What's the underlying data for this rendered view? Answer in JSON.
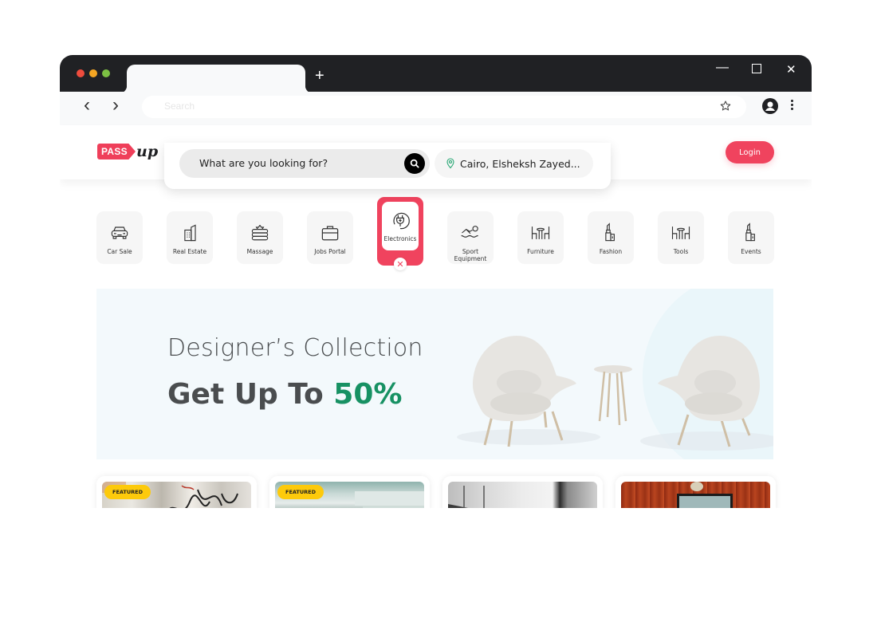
{
  "browser": {
    "new_tab_symbol": "+",
    "window_controls": {
      "minimize": "—",
      "maximize": "☐",
      "close": "✕"
    },
    "nav": {
      "back": "‹",
      "forward": "›"
    },
    "address_placeholder": "Search"
  },
  "header": {
    "logo_pass": "PASS",
    "logo_up": "up",
    "search_placeholder": "What are you looking for?",
    "location": "Cairo, Elsheksh Zayed...",
    "login_label": "Login"
  },
  "categories": [
    {
      "label": "Car Sale",
      "icon": "car-icon",
      "active": false
    },
    {
      "label": "Real Estate",
      "icon": "building-icon",
      "active": false
    },
    {
      "label": "Massage",
      "icon": "spa-towels-icon",
      "active": false
    },
    {
      "label": "Jobs Portal",
      "icon": "briefcase-icon",
      "active": false
    },
    {
      "label": "Electronics",
      "icon": "plug-icon",
      "active": true
    },
    {
      "label": "Sport Equipment",
      "icon": "swimmer-icon",
      "active": false
    },
    {
      "label": "Furniture",
      "icon": "table-chairs-icon",
      "active": false
    },
    {
      "label": "Fashion",
      "icon": "lipstick-icon",
      "active": false
    },
    {
      "label": "Tools",
      "icon": "table-chairs-icon",
      "active": false
    },
    {
      "label": "Events",
      "icon": "lipstick-icon",
      "active": false
    }
  ],
  "banner": {
    "title": "Designer’s Collection",
    "subtitle_prefix": "Get Up To ",
    "subtitle_accent": "50%",
    "accent_color": "#179163"
  },
  "cards": [
    {
      "badge": "FEATURED",
      "image": "graffiti-wall"
    },
    {
      "badge": "FEATURED",
      "image": "building-exterior"
    },
    {
      "badge": "",
      "image": "office-interior"
    },
    {
      "badge": "",
      "image": "living-room-tv"
    }
  ],
  "colors": {
    "brand": "#f0435e",
    "badge": "#fdca0b",
    "titlebar": "#202124"
  }
}
